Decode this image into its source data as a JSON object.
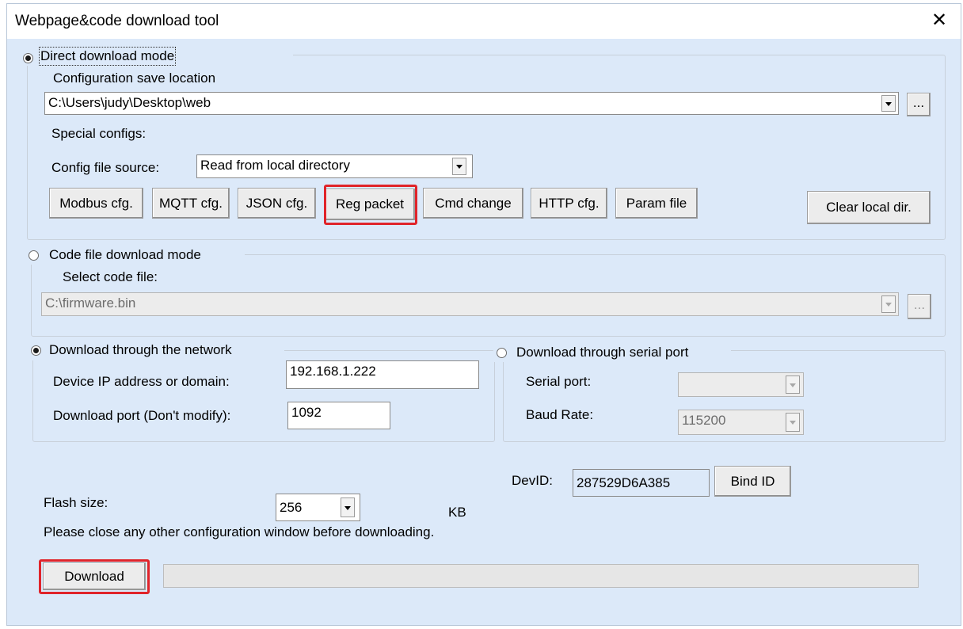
{
  "window": {
    "title": "Webpage&code download tool",
    "close_glyph": "✕"
  },
  "direct_mode": {
    "label": "Direct download mode",
    "selected": true,
    "config_location_label": "Configuration save location",
    "config_location_value": "C:\\Users\\judy\\Desktop\\web",
    "browse_label": "...",
    "special_configs_label": "Special configs:",
    "config_source_label": "Config file source:",
    "config_source_value": "Read from local directory",
    "buttons": [
      "Modbus cfg.",
      "MQTT cfg.",
      "JSON cfg.",
      "Reg packet",
      "Cmd change",
      "HTTP cfg.",
      "Param file"
    ],
    "clear_button": "Clear local dir.",
    "highlighted_button": "Reg packet"
  },
  "code_mode": {
    "label": "Code file download mode",
    "selected": false,
    "select_file_label": "Select code file:",
    "file_value": "C:\\firmware.bin",
    "browse_label": "..."
  },
  "network": {
    "label": "Download through the network",
    "selected": true,
    "ip_label": "Device IP address or domain:",
    "ip_value": "192.168.1.222",
    "port_label": "Download port (Don't modify):",
    "port_value": "1092"
  },
  "serial": {
    "label": "Download through serial port",
    "selected": false,
    "port_label": "Serial port:",
    "port_value": "",
    "baud_label": "Baud Rate:",
    "baud_value": "115200"
  },
  "device": {
    "devid_label": "DevID:",
    "devid_value": "287529D6A385",
    "bind_button": "Bind ID"
  },
  "flash": {
    "label": "Flash size:",
    "value": "256",
    "unit": "KB"
  },
  "notice": "Please close any other configuration window before downloading.",
  "download": {
    "button": "Download",
    "progress": 0
  },
  "colors": {
    "highlight": "#e0242a",
    "dialog_bg": "#dce9f9"
  }
}
